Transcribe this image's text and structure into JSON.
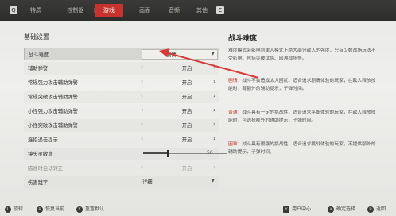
{
  "topbar": {
    "left_key": "Q",
    "right_key": "E",
    "tabs": [
      {
        "label": "特质",
        "active": false
      },
      {
        "label": "控制器",
        "active": false
      },
      {
        "label": "游戏",
        "active": true
      },
      {
        "label": "画面",
        "active": false
      },
      {
        "label": "音频",
        "active": false
      },
      {
        "label": "其他",
        "active": false
      }
    ]
  },
  "settings": {
    "section_title": "基础设置",
    "rows": [
      {
        "label": "战斗难度",
        "type": "dropdown",
        "value": "剧情",
        "selected": true
      },
      {
        "label": "辅助弹警",
        "type": "toggle",
        "value": "开启"
      },
      {
        "label": "常规强力攻击辅助弹警",
        "type": "toggle",
        "value": "开启"
      },
      {
        "label": "常规突破攻击辅助弹警",
        "type": "toggle",
        "value": "开启"
      },
      {
        "label": "小怪强力攻击辅助弹警",
        "type": "toggle",
        "value": "开启"
      },
      {
        "label": "小怪突破攻击辅助弹警",
        "type": "toggle",
        "value": "开启"
      },
      {
        "label": "连招追击提示",
        "type": "toggle",
        "value": "开启"
      },
      {
        "label": "镜头灵敏度",
        "type": "slider",
        "value": "50",
        "fraction": 0.4
      },
      {
        "label": "瞄准时自动转正",
        "type": "toggle",
        "value": "开启",
        "disabled": true
      },
      {
        "label": "伤害跳字",
        "type": "select",
        "value": "详细"
      }
    ]
  },
  "description": {
    "title": "战斗难度",
    "intro": "难度模式会影响到单人模式下绝大部分敌人的强度，只有少数战场玩法不受影响，包括突破试炼、回溯战场等。",
    "items": [
      {
        "name": "剧情",
        "text": "：战斗不会造成太大困扰，适合追求剧情体验的玩家，在敌人释放技能时，有额外的辅助提示，子弹时间。"
      },
      {
        "name": "普通",
        "text": "：战斗具有一定的挑战性，适合追求平衡体验的玩家，在敌人释放技能时，可选择额外的辅助提示，子弹时间。"
      },
      {
        "name": "困难",
        "text": "：战斗具有很强的挑战性，适合追求挑战体验的玩家，不提供额外的辅助提示，子弹时间。"
      }
    ]
  },
  "bottom_hints": [
    {
      "key": "L",
      "label": "旋转"
    },
    {
      "key": "R",
      "label": "恢复当前"
    },
    {
      "key": "X",
      "label": "重置默认"
    },
    {
      "key": "Y",
      "label": "用户中心"
    },
    {
      "key": "A",
      "label": "确定选择"
    },
    {
      "key": "B",
      "label": "返回"
    }
  ],
  "colors": {
    "accent": "#c8322e",
    "annotation": "#d83a36",
    "topbar": "#2f2f2d"
  }
}
